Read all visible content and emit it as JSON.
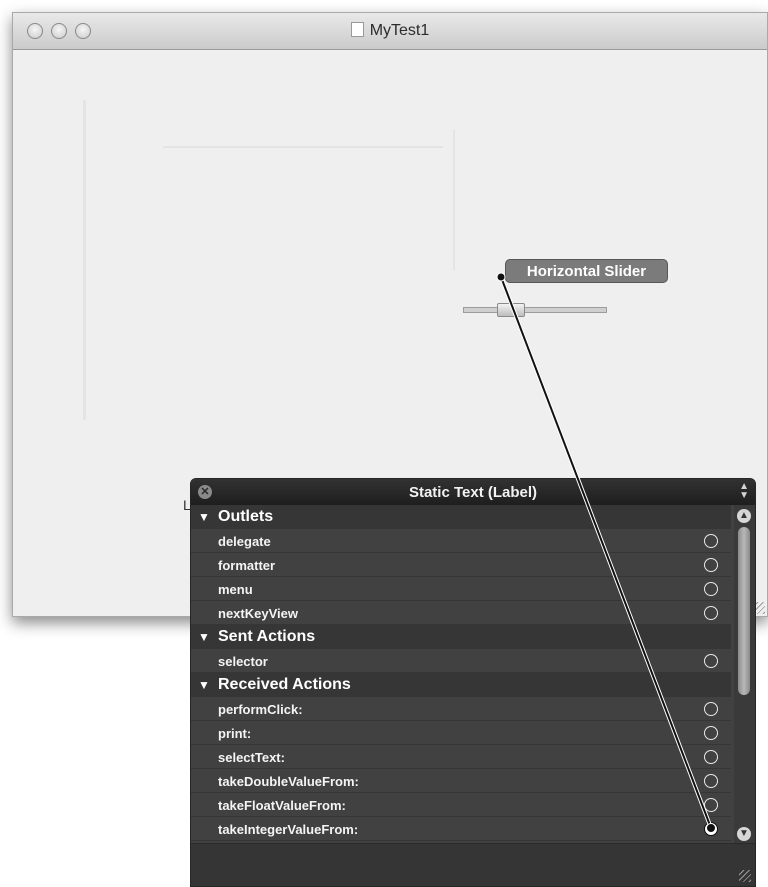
{
  "window": {
    "title": "MyTest1",
    "traffic_lights": [
      "close-button",
      "minimize-button",
      "zoom-button"
    ]
  },
  "canvas": {
    "slider_badge": "Horizontal Slider",
    "label_stub": "Label"
  },
  "hud": {
    "title": "Static Text (Label)",
    "close_glyph": "✕",
    "popup_glyph": "▲▼",
    "sections": [
      {
        "label": "Outlets",
        "items": [
          "delegate",
          "formatter",
          "menu",
          "nextKeyView"
        ]
      },
      {
        "label": "Sent Actions",
        "items": [
          "selector"
        ]
      },
      {
        "label": "Received Actions",
        "items": [
          "performClick:",
          "print:",
          "selectText:",
          "takeDoubleValueFrom:",
          "takeFloatValueFrom:",
          "takeIntegerValueFrom:"
        ]
      }
    ],
    "connected_item": "takeIntegerValueFrom:",
    "scroll_up_glyph": "▲",
    "scroll_down_glyph": "▼"
  },
  "colors": {
    "hud_background": "#414141",
    "hud_section": "#363636",
    "slider_badge": "#7b7b7b",
    "window_background": "#efefef"
  }
}
